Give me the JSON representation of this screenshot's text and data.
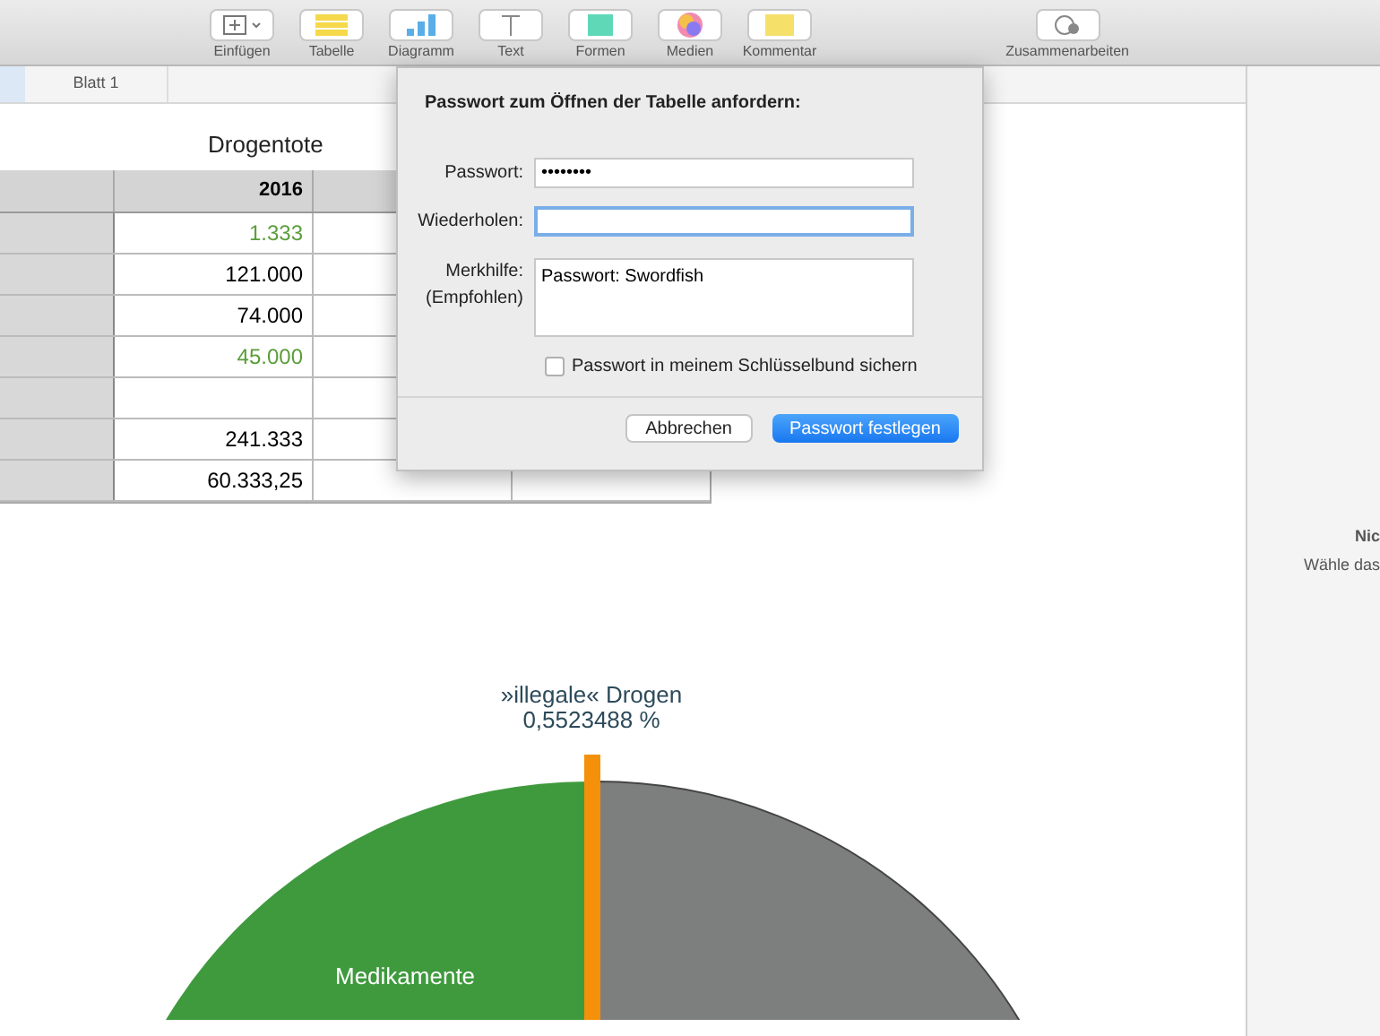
{
  "toolbar": {
    "items": [
      {
        "label": "Einfügen"
      },
      {
        "label": "Tabelle"
      },
      {
        "label": "Diagramm"
      },
      {
        "label": "Text"
      },
      {
        "label": "Formen"
      },
      {
        "label": "Medien"
      },
      {
        "label": "Kommentar"
      }
    ],
    "collaborate": {
      "label": "Zusammenarbeiten"
    }
  },
  "sheet_tabs": [
    {
      "label": "Blatt 1"
    }
  ],
  "table": {
    "title": "Drogentote",
    "header": [
      "2016"
    ],
    "rows": [
      {
        "value": "1.333",
        "color": "#5a9e3a"
      },
      {
        "value": "121.000",
        "color": "#000000"
      },
      {
        "value": "74.000",
        "color": "#000000"
      },
      {
        "value": "45.000",
        "color": "#5a9e3a"
      },
      {},
      {
        "value": "241.333",
        "color": "#000000"
      },
      {
        "value": "60.333,25",
        "color": "#000000"
      }
    ]
  },
  "chart": {
    "label_top": "»illegale« Drogen",
    "label_top_value": "0,5523488 %",
    "label_left": "Medikamente"
  },
  "dialog": {
    "title": "Passwort zum Öffnen der Tabelle anfordern:",
    "fields": [
      {
        "label": "Passwort:",
        "value": "••••••••",
        "focused": false
      },
      {
        "label": "Wiederholen:",
        "focused": true
      }
    ],
    "hint": {
      "label_1": "Merkhilfe:",
      "label_2": "(Empfohlen)",
      "value": "Passwort: Swordfish"
    },
    "keychain": {
      "label": "Passwort in meinem Schlüsselbund sichern",
      "checked": false
    },
    "buttons": [
      {
        "label": "Abbrechen",
        "default": false
      },
      {
        "label": "Passwort festlegen",
        "default": true
      }
    ]
  },
  "sidebar": {
    "title": "Nic",
    "text": "Wähle das"
  }
}
